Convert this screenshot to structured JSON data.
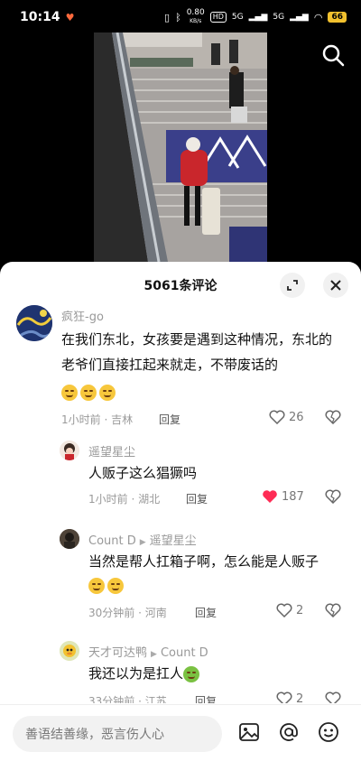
{
  "status_bar": {
    "time": "10:14",
    "net_speed_top": "0.80",
    "net_speed_unit": "KB/s",
    "hd": "HD",
    "signal1": "5G",
    "signal2": "5G",
    "battery": "66"
  },
  "comments_header": {
    "title": "5061条评论"
  },
  "comments": [
    {
      "author": "疯狂-go",
      "text": "在我们东北，女孩要是遇到这种情况，东北的老爷们直接扛起来就走，不带废话的",
      "emoji_count": 3,
      "time_loc": "1小时前 · 吉林",
      "reply_label": "回复",
      "likes": "26",
      "liked": false
    },
    {
      "author": "遥望星尘",
      "text": "人贩子这么猖獗吗",
      "time_loc": "1小时前 · 湖北",
      "reply_label": "回复",
      "likes": "187",
      "liked": true
    },
    {
      "author": "Count D",
      "reply_to": "遥望星尘",
      "text": "当然是帮人扛箱子啊，怎么能是人贩子",
      "emoji_count": 2,
      "time_loc": "30分钟前 · 河南",
      "reply_label": "回复",
      "likes": "2",
      "liked": false
    },
    {
      "author": "天才可达鸭",
      "reply_to": "Count D",
      "text": "我还以为是扛人",
      "time_loc": "33分钟前 · 江苏",
      "reply_label": "回复",
      "likes": "2",
      "liked": false
    }
  ],
  "input_bar": {
    "placeholder": "善语结善缘，恶言伤人心"
  },
  "colors": {
    "like_active": "#fe2c55",
    "battery": "#f2c12e"
  }
}
